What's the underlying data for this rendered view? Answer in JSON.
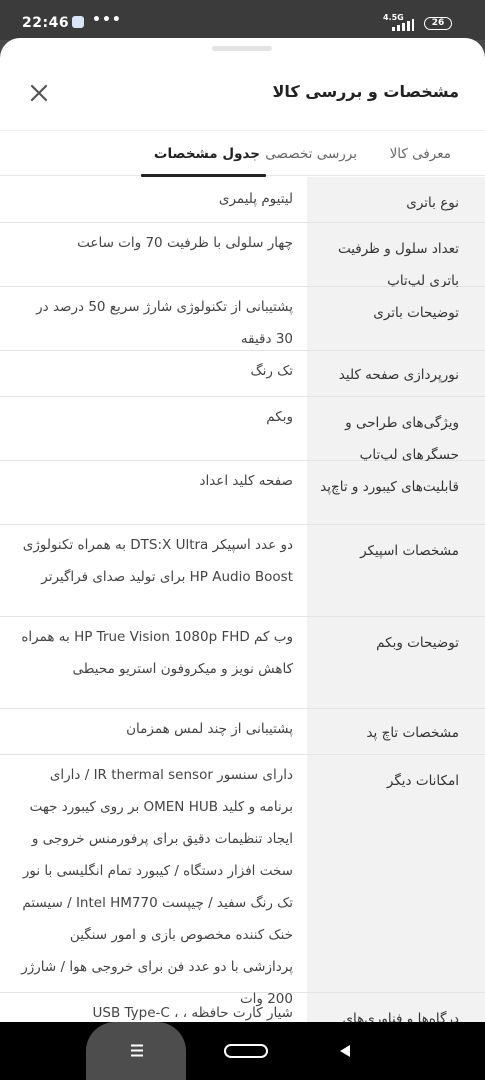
{
  "status_bar": {
    "time": "22:46",
    "notification_dots": "•••",
    "network": "4.5G",
    "battery": "26",
    "icons": [
      "app-notification-icon",
      "signal-icon",
      "battery-icon"
    ]
  },
  "sheet": {
    "title": "مشخصات و بررسی کالا",
    "close_icon": "close-icon"
  },
  "tabs": [
    {
      "label": "معرفی کالا",
      "active": false
    },
    {
      "label": "بررسی تخصصی",
      "active": false
    },
    {
      "label": "جدول مشخصات",
      "active": true
    }
  ],
  "specs": [
    {
      "label": "نوع باتری",
      "value": "لیتیوم پلیمری"
    },
    {
      "label": "تعداد سلول و ظرفیت باتری لپ‌تاپ",
      "value": "چهار سلولی با ظرفیت 70 وات ساعت"
    },
    {
      "label": "توضیحات باتری",
      "value": "پشتیبانی از تکنولوژی شارژ سریع 50 درصد در 30 دقیقه"
    },
    {
      "label": "نورپردازی صفحه کلید",
      "value": "تک رنگ"
    },
    {
      "label": "ویژگی‌های طراحی و حسگرهای لپ‌تاپ",
      "value": "وبکم"
    },
    {
      "label": "قابلیت‌های کیبورد و تاچ‌پد",
      "value": "صفحه کلید اعداد"
    },
    {
      "label": "مشخصات اسپیکر",
      "value": "دو عدد اسپیکر DTS:X Ultra به همراه تکنولوژی HP Audio Boost برای تولید صدای فراگیرتر"
    },
    {
      "label": "توضیحات وبکم",
      "value": "وب کم HP True Vision 1080p FHD به همراه کاهش نویز و میکروفون استریو محیطی"
    },
    {
      "label": "مشخصات تاچ پد",
      "value": "پشتیبانی از چند لمس همزمان"
    },
    {
      "label": "امکانات دیگر",
      "value": "دارای سنسور IR thermal sensor / دارای برنامه و کلید OMEN HUB بر روی کیبورد جهت ایجاد تنظیمات دقیق برای پرفورمنس خروجی و سخت افزار دستگاه / کیبورد تمام انگلیسی با نور تک رنگ سفید / چیپست Intel HM770 / سیستم خنک کننده مخصوص بازی و امور سنگین پردازشی با دو عدد فن برای خروجی هوا / شارژر 200 وات"
    },
    {
      "label": "درگاه‌ها و فناوری‌های",
      "value": "شیار کارت حافظه ، ، USB Type-C"
    }
  ],
  "nav_bar": {
    "menu_icon": "menu-icon",
    "home_icon": "home-pill-icon",
    "back_icon": "back-triangle-icon"
  }
}
